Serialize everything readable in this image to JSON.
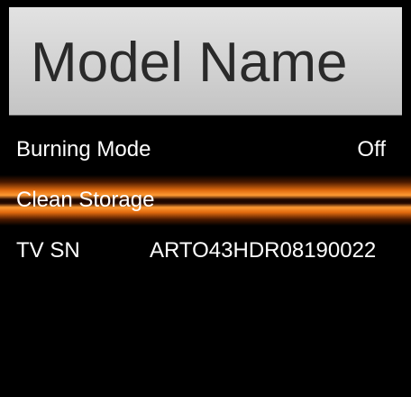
{
  "header": {
    "title": "Model Name"
  },
  "menu": {
    "items": [
      {
        "label": "Burning Mode",
        "value": "Off",
        "selected": false
      },
      {
        "label": "Clean Storage",
        "value": "",
        "selected": true
      },
      {
        "label": "TV SN",
        "value": "ARTO43HDR08190022",
        "selected": false
      }
    ]
  },
  "colors": {
    "background": "#000000",
    "title_bar": "#d2d2d2",
    "title_text": "#2a2a2a",
    "highlight": "#ff9a33",
    "text": "#ffffff"
  }
}
